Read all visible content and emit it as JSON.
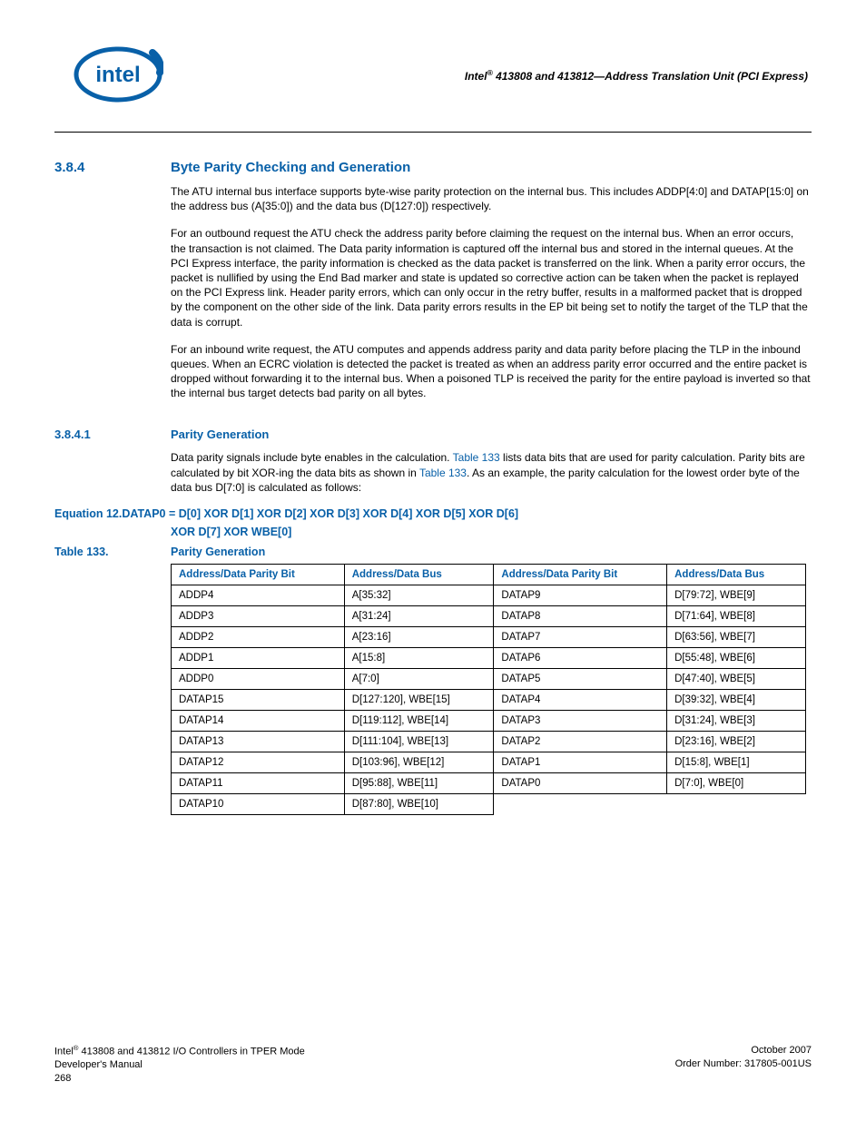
{
  "header": {
    "title_html": "Intel<sup>®</sup> 413808 and 413812—Address Translation Unit (PCI Express)"
  },
  "sec384": {
    "num": "3.8.4",
    "title": "Byte Parity Checking and Generation",
    "p1": "The ATU internal bus interface supports byte-wise parity protection on the internal bus. This includes ADDP[4:0] and DATAP[15:0] on the address bus (A[35:0]) and the data bus (D[127:0]) respectively.",
    "p2": "For an outbound request the ATU check the address parity before claiming the request on the internal bus. When an error occurs, the transaction is not claimed. The Data parity information is captured off the internal bus and stored in the internal queues. At the PCI Express interface, the parity information is checked as the data packet is transferred on the link. When a parity error occurs, the packet is nullified by using the End Bad marker and state is updated so corrective action can be taken when the packet is replayed on the PCI Express link. Header parity errors, which can only occur in the retry buffer, results in a malformed packet that is dropped by the component on the other side of the link. Data parity errors results in the EP bit being set to notify the target of the TLP that the data is corrupt.",
    "p3": "For an inbound write request, the ATU computes and appends address parity and data parity before placing the TLP in the inbound queues. When an ECRC violation is detected the packet is treated as when an address parity error occurred and the entire packet is dropped without forwarding it to the internal bus. When a poisoned TLP is received the parity for the entire payload is inverted so that the internal bus target detects bad parity on all bytes."
  },
  "sec3841": {
    "num": "3.8.4.1",
    "title": "Parity Generation",
    "p1_pre": "Data parity signals include byte enables in the calculation. ",
    "link1": "Table 133",
    "p1_mid": " lists data bits that are used for parity calculation. Parity bits are calculated by bit XOR-ing the data bits as shown in ",
    "link2": "Table 133",
    "p1_post": ". As an example, the parity calculation for the lowest order byte of the data bus D[7:0] is calculated as follows:"
  },
  "equation": {
    "label": "Equation 12.",
    "line1": "DATAP0 = D[0] XOR D[1] XOR D[2] XOR D[3] XOR D[4] XOR D[5] XOR D[6]",
    "line2": "XOR D[7] XOR WBE[0]"
  },
  "table133": {
    "label": "Table 133.",
    "title": "Parity Generation",
    "headers": [
      "Address/Data Parity Bit",
      "Address/Data Bus",
      "Address/Data Parity Bit",
      "Address/Data Bus"
    ],
    "rows": [
      [
        "ADDP4",
        "A[35:32]",
        "DATAP9",
        "D[79:72], WBE[9]"
      ],
      [
        "ADDP3",
        "A[31:24]",
        "DATAP8",
        "D[71:64], WBE[8]"
      ],
      [
        "ADDP2",
        "A[23:16]",
        "DATAP7",
        "D[63:56], WBE[7]"
      ],
      [
        "ADDP1",
        "A[15:8]",
        "DATAP6",
        "D[55:48], WBE[6]"
      ],
      [
        "ADDP0",
        "A[7:0]",
        "DATAP5",
        "D[47:40], WBE[5]"
      ],
      [
        "DATAP15",
        "D[127:120], WBE[15]",
        "DATAP4",
        "D[39:32], WBE[4]"
      ],
      [
        "DATAP14",
        "D[119:112], WBE[14]",
        "DATAP3",
        "D[31:24], WBE[3]"
      ],
      [
        "DATAP13",
        "D[111:104], WBE[13]",
        "DATAP2",
        "D[23:16], WBE[2]"
      ],
      [
        "DATAP12",
        "D[103:96], WBE[12]",
        "DATAP1",
        "D[15:8], WBE[1]"
      ],
      [
        "DATAP11",
        "D[95:88], WBE[11]",
        "DATAP0",
        "D[7:0], WBE[0]"
      ],
      [
        "DATAP10",
        "D[87:80], WBE[10]",
        "",
        ""
      ]
    ]
  },
  "footer": {
    "left1_html": "Intel<sup>®</sup> 413808 and 413812 I/O Controllers in TPER Mode",
    "left2": "Developer's Manual",
    "left3": "268",
    "right1": "October 2007",
    "right2": "Order Number: 317805-001US"
  }
}
